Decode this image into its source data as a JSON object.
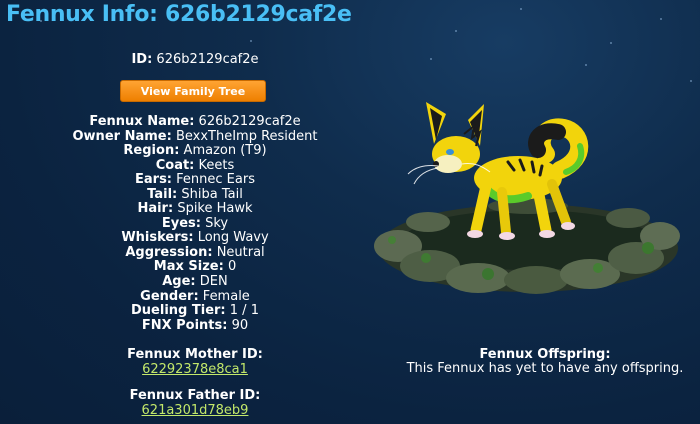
{
  "page": {
    "title": "Fennux Info: 626b2129caf2e"
  },
  "id_line": {
    "label": "ID:",
    "value": "626b2129caf2e"
  },
  "family_tree_button": "View Family Tree",
  "info": [
    {
      "label": "Fennux Name:",
      "value": "626b2129caf2e"
    },
    {
      "label": "Owner Name:",
      "value": "BexxTheImp Resident"
    },
    {
      "label": "Region:",
      "value": "Amazon (T9)"
    },
    {
      "label": "Coat:",
      "value": "Keets"
    },
    {
      "label": "Ears:",
      "value": "Fennec Ears"
    },
    {
      "label": "Tail:",
      "value": "Shiba Tail"
    },
    {
      "label": "Hair:",
      "value": "Spike Hawk"
    },
    {
      "label": "Eyes:",
      "value": "Sky"
    },
    {
      "label": "Whiskers:",
      "value": "Long Wavy"
    },
    {
      "label": "Aggression:",
      "value": "Neutral"
    },
    {
      "label": "Max Size:",
      "value": "0"
    },
    {
      "label": "Age:",
      "value": "DEN"
    },
    {
      "label": "Gender:",
      "value": "Female"
    },
    {
      "label": "Dueling Tier:",
      "value": "1 / 1"
    },
    {
      "label": "FNX Points:",
      "value": "90"
    }
  ],
  "mother": {
    "label": "Fennux Mother ID:",
    "value": "62292378e8ca1"
  },
  "father": {
    "label": "Fennux Father ID:",
    "value": "621a301d78eb9"
  },
  "offspring": {
    "label": "Fennux Offspring:",
    "text": "This Fennux has yet to have any offspring."
  },
  "colors": {
    "title": "#49bff5",
    "background": "#0f2c4c",
    "button": "#f58a10",
    "link": "#c3e86a"
  }
}
